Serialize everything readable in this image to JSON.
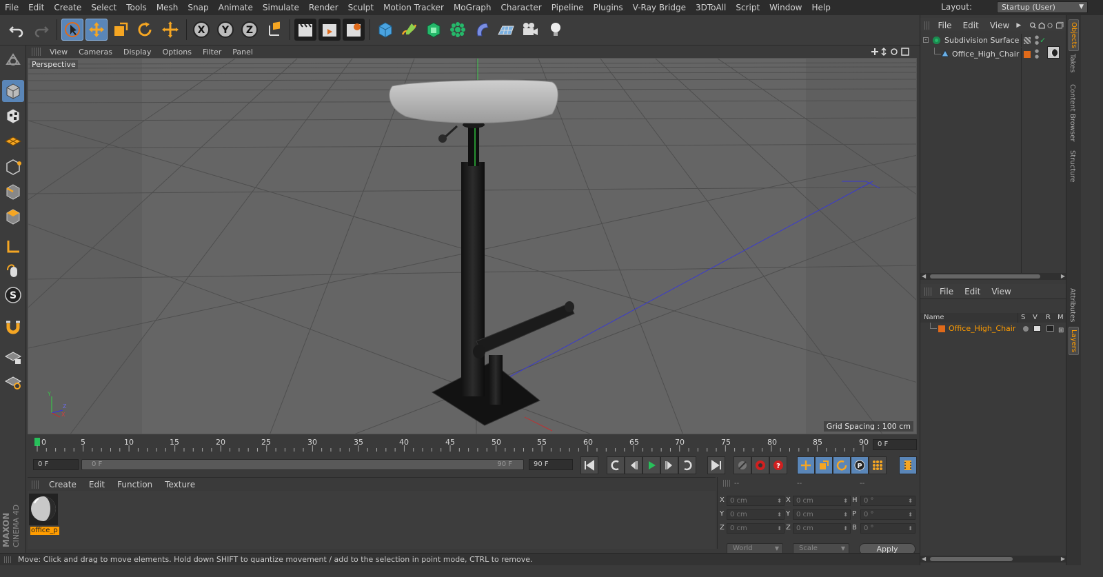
{
  "menubar": {
    "items": [
      "File",
      "Edit",
      "Create",
      "Select",
      "Tools",
      "Mesh",
      "Snap",
      "Animate",
      "Simulate",
      "Render",
      "Sculpt",
      "Motion Tracker",
      "MoGraph",
      "Character",
      "Pipeline",
      "Plugins",
      "V-Ray Bridge",
      "3DToAll",
      "Script",
      "Window",
      "Help"
    ],
    "layout_label": "Layout:",
    "layout_value": "Startup (User)"
  },
  "toolbar": {
    "axis_x": "X",
    "axis_y": "Y",
    "axis_z": "Z"
  },
  "viewport": {
    "menu": [
      "View",
      "Cameras",
      "Display",
      "Options",
      "Filter",
      "Panel"
    ],
    "label": "Perspective",
    "grid_spacing": "Grid Spacing : 100 cm",
    "axis_labels": {
      "y": "Y",
      "z": "Z",
      "x": "X"
    }
  },
  "timeline": {
    "ticks": [
      "0",
      "5",
      "10",
      "15",
      "20",
      "25",
      "30",
      "35",
      "40",
      "45",
      "50",
      "55",
      "60",
      "65",
      "70",
      "75",
      "80",
      "85",
      "90"
    ],
    "current_frame_right": "0 F"
  },
  "transport": {
    "start_field": "0 F",
    "range_start": "0 F",
    "range_end": "90 F",
    "end_field": "90 F"
  },
  "material_manager": {
    "menu": [
      "Create",
      "Edit",
      "Function",
      "Texture"
    ],
    "materials": [
      {
        "name": "office_p"
      }
    ]
  },
  "coordinates": {
    "col_headers": [
      "--",
      "--",
      "--"
    ],
    "rows": [
      {
        "l1": "X",
        "v1": "0 cm",
        "l2": "X",
        "v2": "0 cm",
        "l3": "H",
        "v3": "0 °"
      },
      {
        "l1": "Y",
        "v1": "0 cm",
        "l2": "Y",
        "v2": "0 cm",
        "l3": "P",
        "v3": "0 °"
      },
      {
        "l1": "Z",
        "v1": "0 cm",
        "l2": "Z",
        "v2": "0 cm",
        "l3": "B",
        "v3": "0 °"
      }
    ],
    "mode_world": "World",
    "mode_scale": "Scale",
    "apply": "Apply"
  },
  "status": {
    "text": "Move: Click and drag to move elements. Hold down SHIFT to quantize movement / add to the selection in point mode, CTRL to remove."
  },
  "branding": {
    "line1": "MAXON",
    "line2": "CINEMA 4D"
  },
  "object_manager": {
    "menu": [
      "File",
      "Edit",
      "View"
    ],
    "objects": [
      {
        "name": "Subdivision Surface",
        "icon": "subdivision-icon"
      },
      {
        "name": "Office_High_Chair",
        "icon": "polygon-object-icon"
      }
    ]
  },
  "layer_manager": {
    "menu": [
      "File",
      "Edit",
      "View"
    ],
    "columns": {
      "name": "Name",
      "s": "S",
      "v": "V",
      "r": "R",
      "m": "M"
    },
    "layers": [
      {
        "name": "Office_High_Chair",
        "color": "#e06a1a"
      }
    ]
  },
  "side_tabs": [
    "Objects",
    "Takes",
    "Content Browser",
    "Structure",
    "Attributes",
    "Layers"
  ],
  "colors": {
    "accent": "#5a86b8",
    "highlight_orange": "#ff9c00",
    "viewport_bg": "#656565",
    "layer_color": "#e06a1a"
  }
}
